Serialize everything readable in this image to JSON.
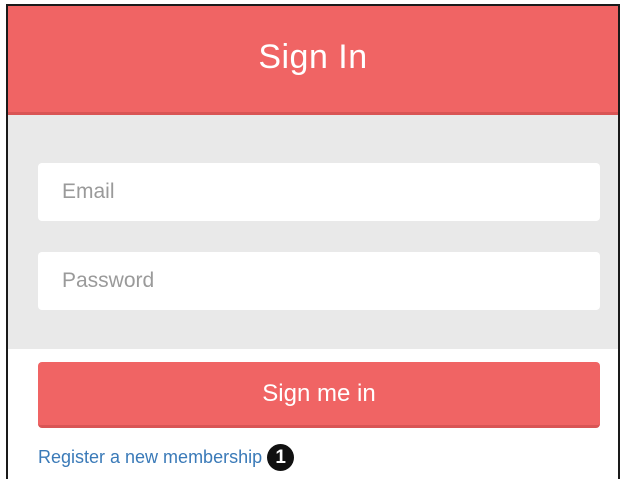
{
  "header": {
    "title": "Sign In"
  },
  "form": {
    "email_placeholder": "Email",
    "password_placeholder": "Password",
    "submit_label": "Sign me in"
  },
  "footer": {
    "register_label": "Register a new membership",
    "marker_number": "1"
  },
  "colors": {
    "accent": "#f06464",
    "form_background": "#e9e9e9",
    "link": "#3a7ab8"
  }
}
